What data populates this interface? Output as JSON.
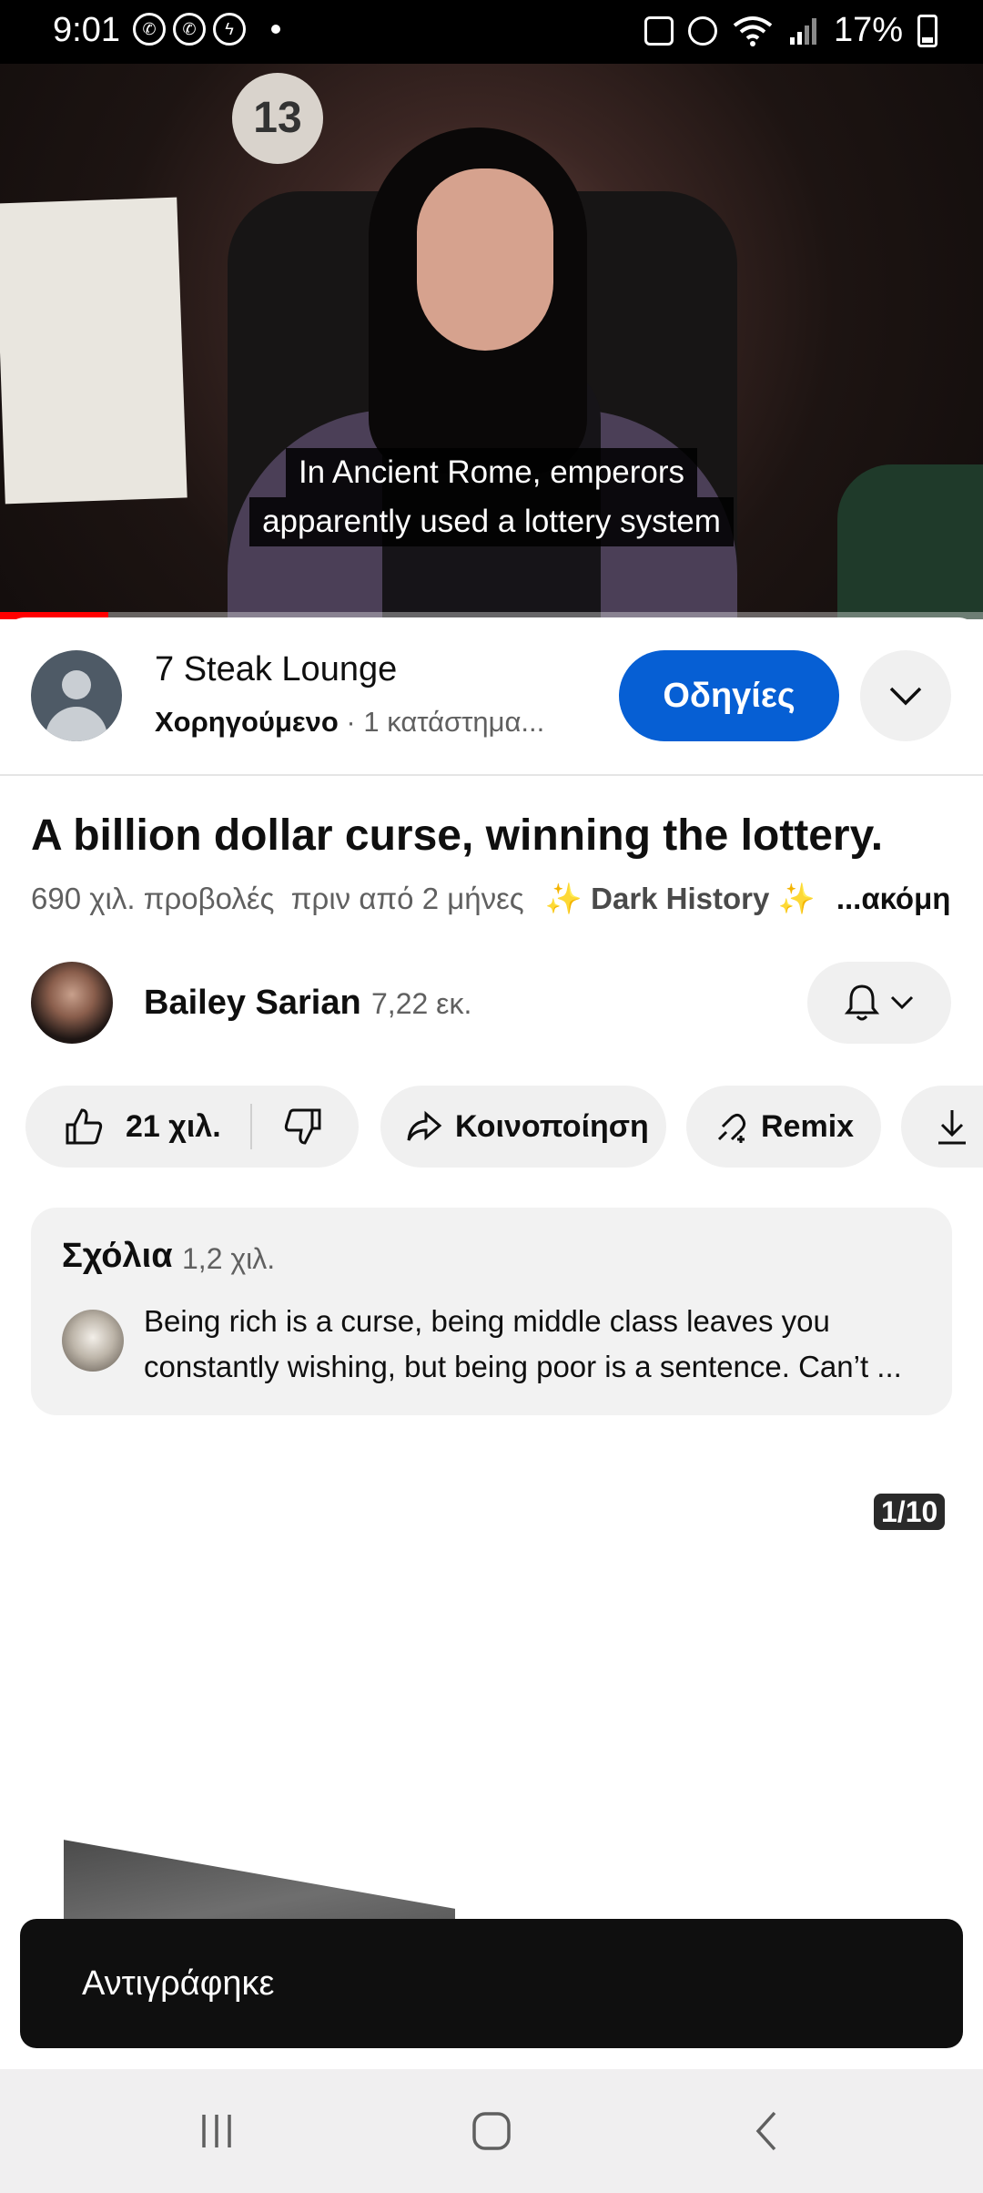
{
  "status_bar": {
    "time": "9:01",
    "battery": "17%"
  },
  "video": {
    "caption_line1": "In Ancient Rome, emperors",
    "caption_line2": "apparently used a lottery system",
    "overlay_number": "13",
    "progress_fraction": 0.11
  },
  "ad": {
    "title": "7 Steak Lounge",
    "sponsored": "Χορηγούμενο",
    "detail": " · 1 κατάστημα...",
    "button_label": "Οδηγίες"
  },
  "video_info": {
    "title": "A billion dollar curse, winning the lottery.",
    "views": "690 χιλ. προβολές",
    "age": "πριν από 2 μήνες",
    "hashtag": "✨ Dark History ✨",
    "more": "...ακόμη"
  },
  "channel": {
    "name": "Bailey Sarian",
    "subscribers": "7,22 εκ."
  },
  "actions": {
    "likes": "21 χιλ.",
    "share": "Κοινοποίηση",
    "remix": "Remix"
  },
  "comments": {
    "heading": "Σχόλια",
    "count": "1,2 χιλ.",
    "top_comment": "Being rich is a curse, being middle class leaves you constantly wishing, but being poor is a sentence. Can’t ..."
  },
  "pager": "1/10",
  "toast": "Αντιγράφηκε",
  "colors": {
    "accent_blue": "#065fd4",
    "progress_red": "#ff0000",
    "chip_bg": "#f0f0f0"
  }
}
